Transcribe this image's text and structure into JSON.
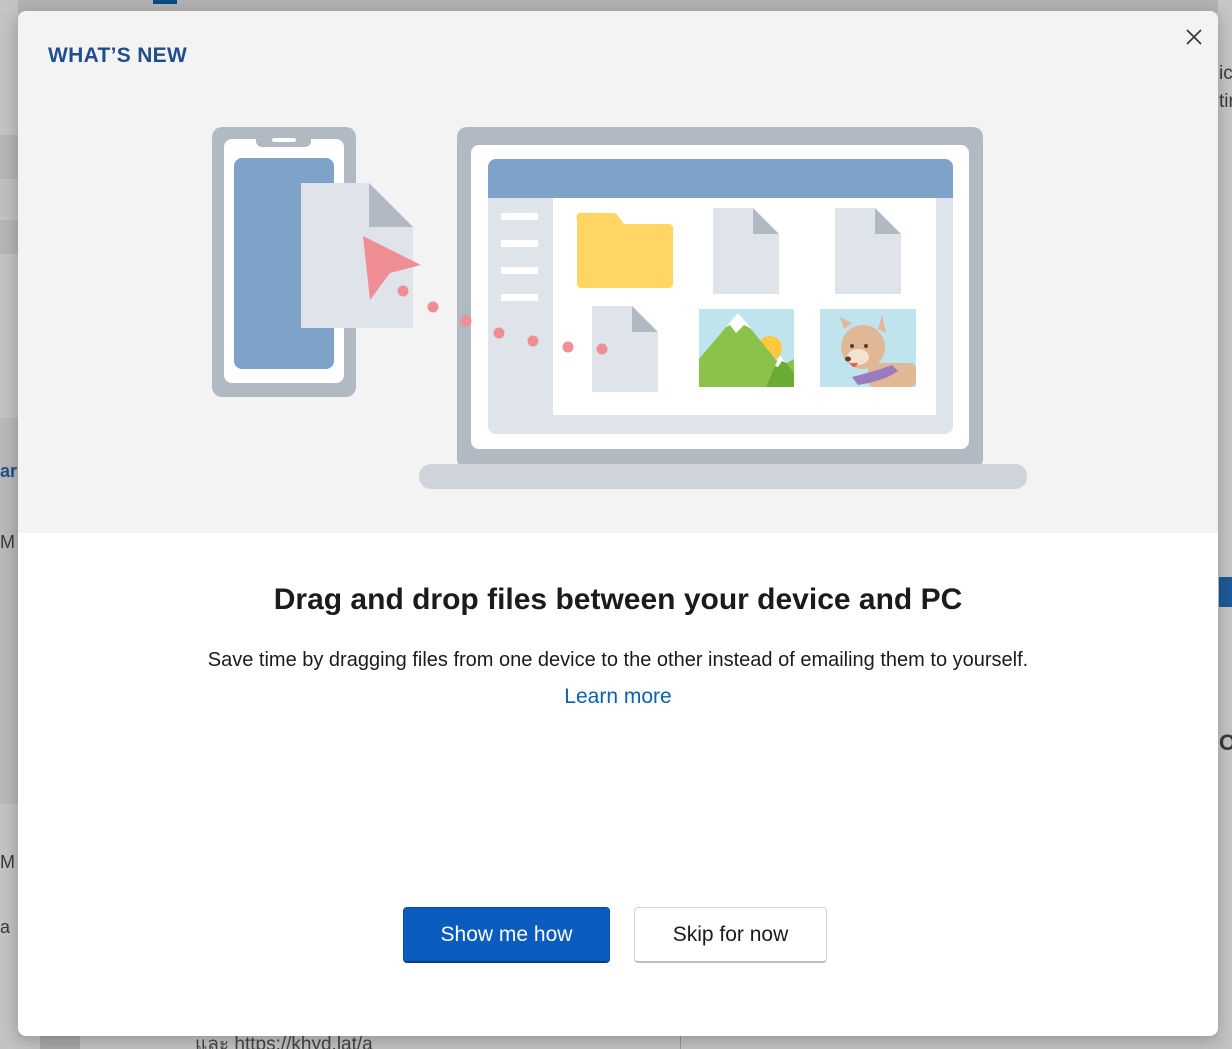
{
  "background": {
    "left_texts": [
      "ar",
      "M",
      "M",
      "a"
    ],
    "right_texts": [
      "ic",
      "tir",
      "O"
    ],
    "bottom_text": "และ https://khyd.lat/a"
  },
  "dialog": {
    "heading": "WHAT’S NEW",
    "close_label": "×",
    "title": "Drag and drop files between your device and PC",
    "description": "Save time by dragging files from one device to the other instead of emailing them to yourself.",
    "learn_more": "Learn more",
    "primary_button": "Show me how",
    "secondary_button": "Skip for now"
  },
  "colors": {
    "accent": "#0a5cbf",
    "heading": "#1f4e8a",
    "link": "#0f5fb0",
    "hero_bg": "#f3f3f3"
  },
  "icons": [
    "close-icon",
    "phone-illustration",
    "laptop-illustration",
    "folder-icon",
    "document-icon",
    "image-icon",
    "cursor-icon"
  ]
}
